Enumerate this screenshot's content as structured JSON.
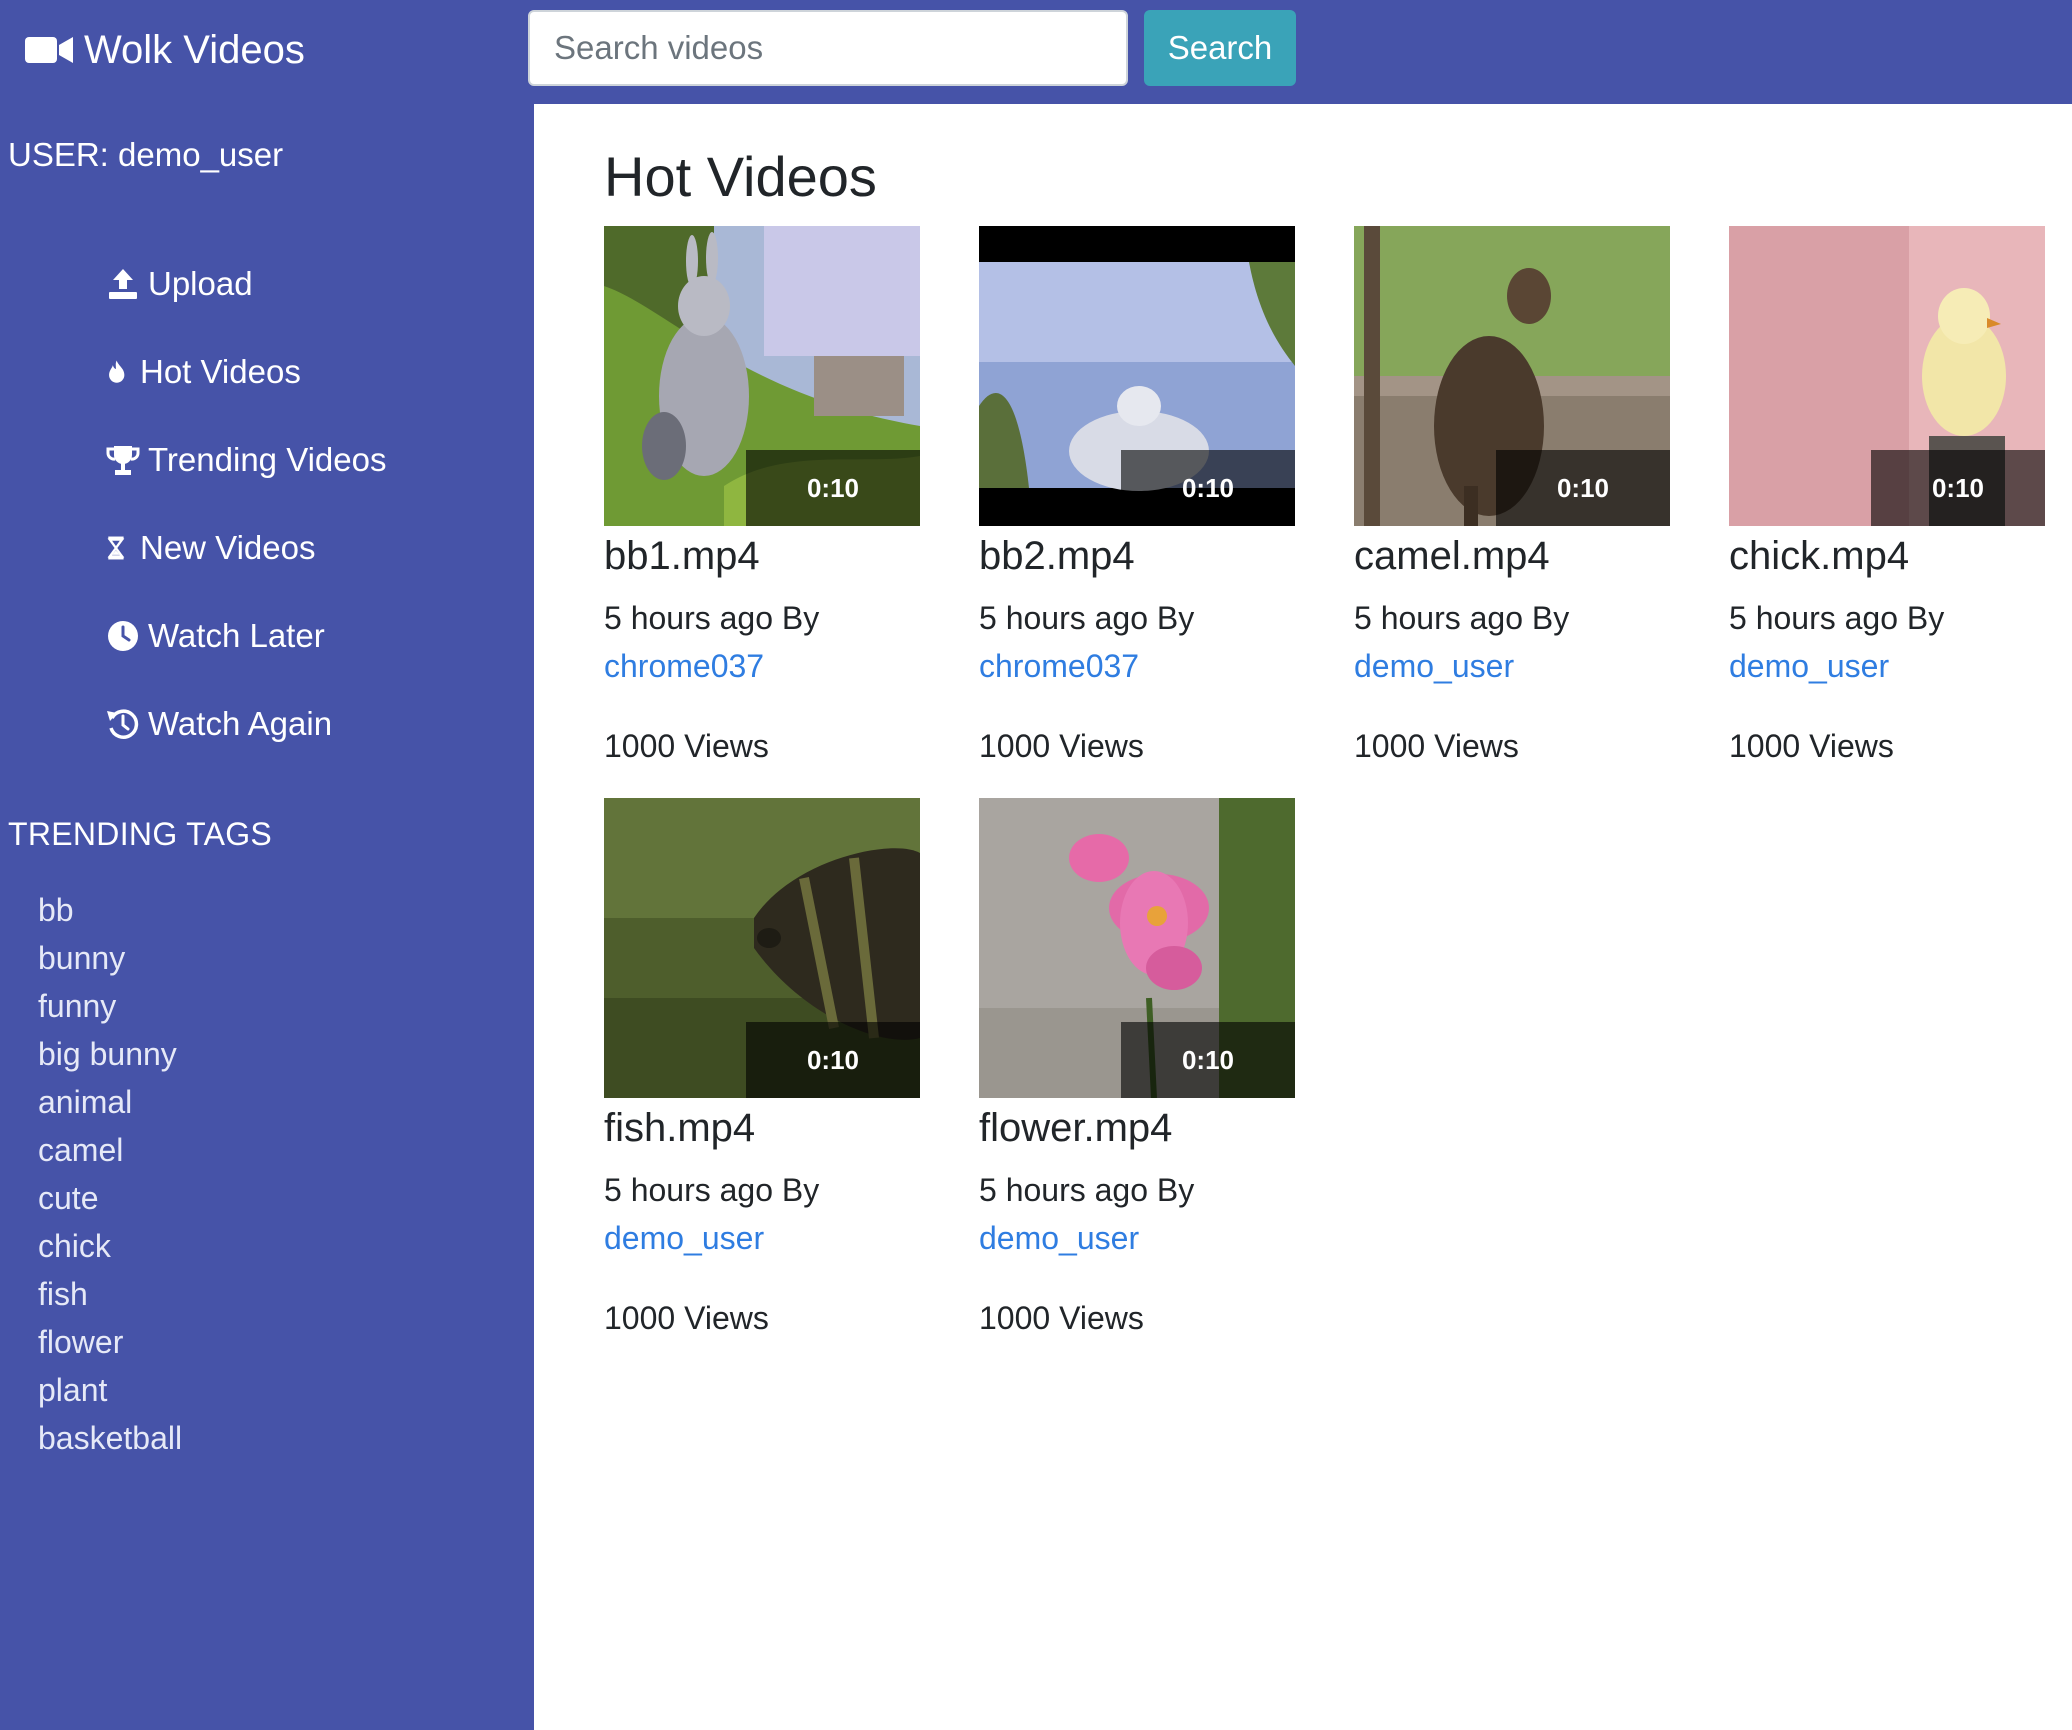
{
  "brand": {
    "name": "Wolk Videos"
  },
  "search": {
    "placeholder": "Search videos",
    "button_label": "Search"
  },
  "sidebar": {
    "user_label": "USER: demo_user",
    "nav": [
      {
        "label": "Upload",
        "icon": "upload-icon"
      },
      {
        "label": "Hot Videos",
        "icon": "fire-icon"
      },
      {
        "label": "Trending Videos",
        "icon": "trophy-icon"
      },
      {
        "label": "New Videos",
        "icon": "hourglass-icon"
      },
      {
        "label": "Watch Later",
        "icon": "clock-icon"
      },
      {
        "label": "Watch Again",
        "icon": "history-icon"
      }
    ],
    "tags_heading": "TRENDING TAGS",
    "tags": [
      "bb",
      "bunny",
      "funny",
      "big bunny",
      "animal",
      "camel",
      "cute",
      "chick",
      "fish",
      "flower",
      "plant",
      "basketball"
    ]
  },
  "main": {
    "title": "Hot Videos",
    "videos": [
      {
        "title": "bb1.mp4",
        "duration": "0:10",
        "time_ago": "5 hours ago By",
        "uploader": "chrome037",
        "views": "1000 Views"
      },
      {
        "title": "bb2.mp4",
        "duration": "0:10",
        "time_ago": "5 hours ago By",
        "uploader": "chrome037",
        "views": "1000 Views"
      },
      {
        "title": "camel.mp4",
        "duration": "0:10",
        "time_ago": "5 hours ago By",
        "uploader": "demo_user",
        "views": "1000 Views"
      },
      {
        "title": "chick.mp4",
        "duration": "0:10",
        "time_ago": "5 hours ago By",
        "uploader": "demo_user",
        "views": "1000 Views"
      },
      {
        "title": "fish.mp4",
        "duration": "0:10",
        "time_ago": "5 hours ago By",
        "uploader": "demo_user",
        "views": "1000 Views"
      },
      {
        "title": "flower.mp4",
        "duration": "0:10",
        "time_ago": "5 hours ago By",
        "uploader": "demo_user",
        "views": "1000 Views"
      }
    ]
  },
  "colors": {
    "nav_bg": "#4653a8",
    "search_button": "#3aa3b8",
    "link": "#2f7de1"
  }
}
